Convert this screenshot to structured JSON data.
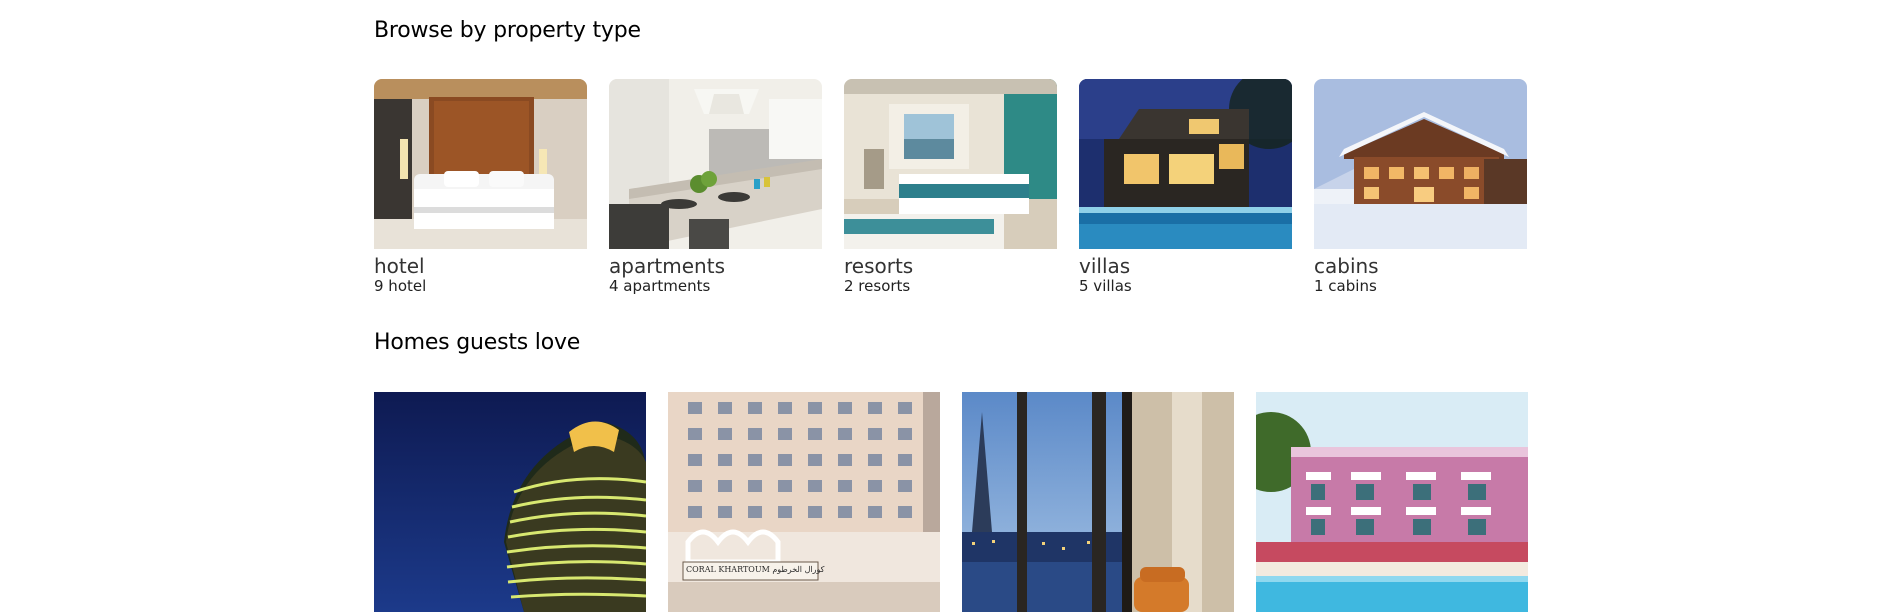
{
  "sections": {
    "browse_title": "Browse by property type",
    "homes_title": "Homes guests love"
  },
  "property_types": [
    {
      "name": "hotel",
      "count": "9 hotel"
    },
    {
      "name": "apartments",
      "count": "4 apartments"
    },
    {
      "name": "resorts",
      "count": "2 resorts"
    },
    {
      "name": "villas",
      "count": "5 villas"
    },
    {
      "name": "cabins",
      "count": "1 cabins"
    }
  ],
  "homes": [
    {
      "sign_text": ""
    },
    {
      "sign_text": "CORAL KHARTOUM كورال الخرطوم"
    },
    {
      "sign_text": ""
    },
    {
      "sign_text": ""
    }
  ]
}
